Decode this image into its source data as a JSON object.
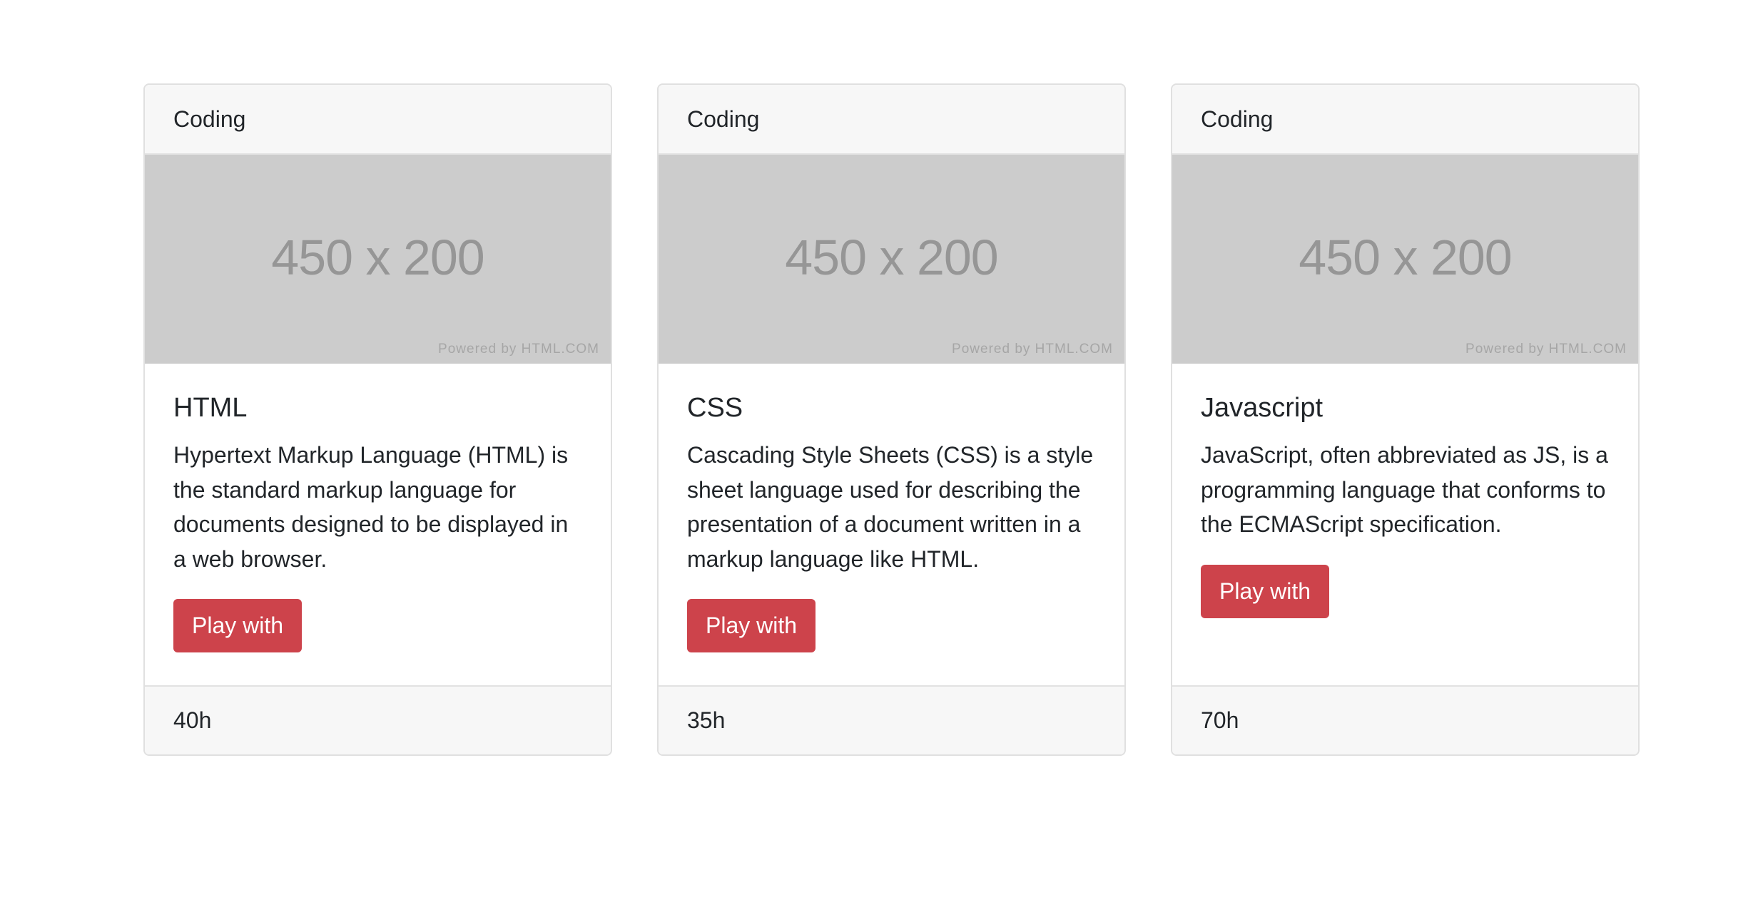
{
  "cards": [
    {
      "header": "Coding",
      "image": {
        "size_label": "450 x 200",
        "powered_label": "Powered by HTML.COM"
      },
      "title": "HTML",
      "text": "Hypertext Markup Language (HTML) is the standard markup language for documents designed to be displayed in a web browser.",
      "button_label": "Play with",
      "footer": "40h"
    },
    {
      "header": "Coding",
      "image": {
        "size_label": "450 x 200",
        "powered_label": "Powered by HTML.COM"
      },
      "title": "CSS",
      "text": "Cascading Style Sheets (CSS) is a style sheet language used for describing the presentation of a document written in a markup language like HTML.",
      "button_label": "Play with",
      "footer": "35h"
    },
    {
      "header": "Coding",
      "image": {
        "size_label": "450 x 200",
        "powered_label": "Powered by HTML.COM"
      },
      "title": "Javascript",
      "text": "JavaScript, often abbreviated as JS, is a programming language that conforms to the ECMAScript specification.",
      "button_label": "Play with",
      "footer": "70h"
    }
  ],
  "colors": {
    "button": "#cd434b",
    "header_bg": "#f7f7f7",
    "placeholder_bg": "#cccccc"
  }
}
